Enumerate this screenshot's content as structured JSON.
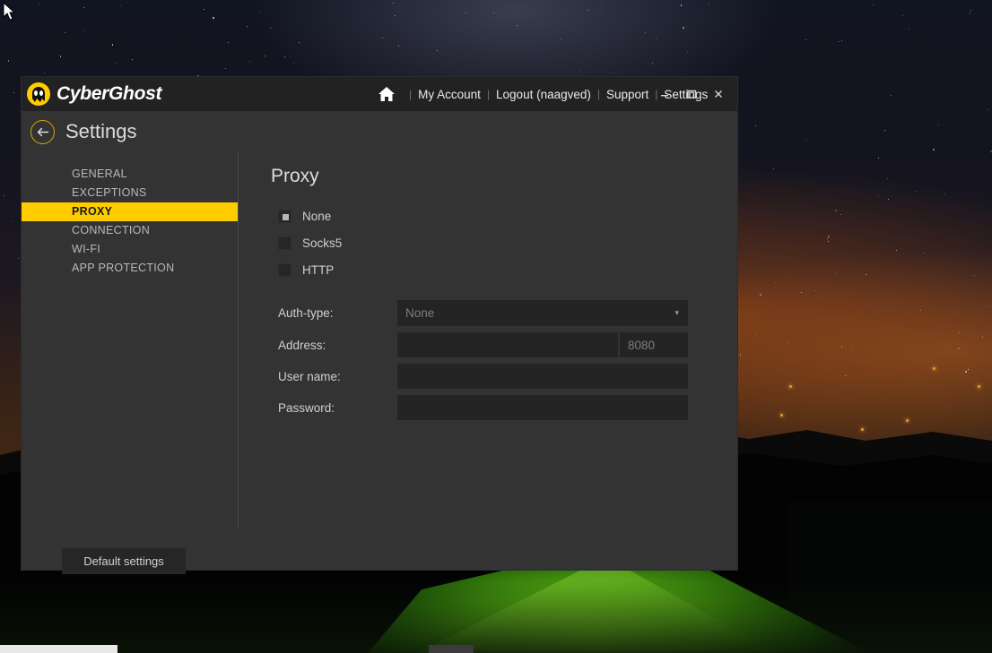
{
  "window": {
    "brand_name": "CyberGhost",
    "logo_icon": "cyberghost-ghost-logo",
    "title_menu": [
      {
        "label": "My Account",
        "icon": null
      },
      {
        "label": "Logout (naagved)",
        "icon": null
      },
      {
        "label": "Support",
        "icon": null
      },
      {
        "label": "Settings",
        "icon": null
      }
    ],
    "home_icon": "home-icon",
    "separator": "|",
    "controls": {
      "minimize": "–",
      "maximize": "☐",
      "close": "✕"
    }
  },
  "header": {
    "back_icon": "arrow-left-icon",
    "title": "Settings"
  },
  "sidebar": {
    "items": [
      {
        "label": "GENERAL",
        "active": false
      },
      {
        "label": "EXCEPTIONS",
        "active": false
      },
      {
        "label": "PROXY",
        "active": true
      },
      {
        "label": "CONNECTION",
        "active": false
      },
      {
        "label": "WI-FI",
        "active": false
      },
      {
        "label": "APP PROTECTION",
        "active": false
      }
    ]
  },
  "content": {
    "title": "Proxy",
    "proxy_modes": [
      {
        "label": "None",
        "selected": true
      },
      {
        "label": "Socks5",
        "selected": false
      },
      {
        "label": "HTTP",
        "selected": false
      }
    ],
    "form": {
      "auth_type": {
        "label": "Auth-type:",
        "value": "None",
        "chevron": "▾"
      },
      "address": {
        "label": "Address:",
        "value": "",
        "placeholder": ""
      },
      "port": {
        "value": "8080"
      },
      "user_name": {
        "label": "User name:",
        "value": "",
        "placeholder": ""
      },
      "password": {
        "label": "Password:",
        "value": "",
        "placeholder": ""
      }
    }
  },
  "footer": {
    "default_settings_label": "Default settings"
  },
  "colors": {
    "accent": "#ffcc00",
    "window_bg": "#333333",
    "titlebar_bg": "#222222",
    "field_bg": "#242424",
    "text": "#cfcfcf"
  },
  "desktop": {
    "wallpaper_description": "night-landscape-with-tent"
  }
}
